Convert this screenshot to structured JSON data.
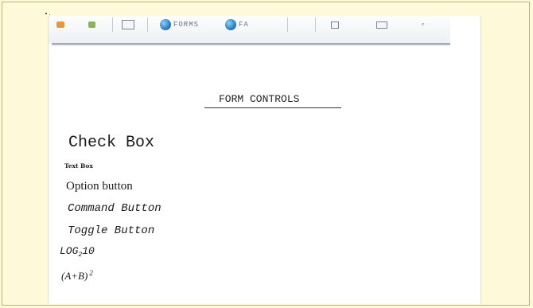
{
  "toolbar": {
    "tab1_label": "FORMS",
    "tab2_label": "FA"
  },
  "document": {
    "heading": "FORM CONTROLS",
    "items": {
      "check_box": "Check Box",
      "text_box": "Text Box",
      "option_button": "Option button",
      "command_button": "Command Button",
      "toggle_button": "Toggle Button",
      "log_prefix": "LOG",
      "log_subscript": "2",
      "log_suffix": "10",
      "ab_base": "(A+B)",
      "ab_exponent": "2"
    }
  }
}
